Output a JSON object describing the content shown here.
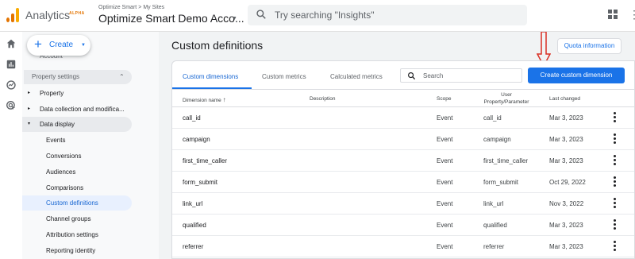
{
  "header": {
    "app_name": "Analytics",
    "badge": "ALPHA",
    "account_crumb_1": "Optimize Smart",
    "account_crumb_sep": ">",
    "account_crumb_2": "My Sites",
    "account_name": "Optimize Smart Demo Acco...",
    "search_placeholder": "Try searching \"Insights\"",
    "icons": [
      "apps-grid-icon",
      "more-vert-icon"
    ]
  },
  "rail": {
    "icons": [
      "home-icon",
      "reports-icon",
      "explore-icon",
      "advertising-icon"
    ]
  },
  "nav": {
    "create_label": "Create",
    "cut_item": "Account",
    "section_label": "Property settings",
    "items": [
      {
        "label": "Property",
        "arrow": "▸"
      },
      {
        "label": "Data collection and modifica...",
        "arrow": "▸"
      },
      {
        "label": "Data display",
        "arrow": "▾"
      },
      {
        "label": "Events"
      },
      {
        "label": "Conversions"
      },
      {
        "label": "Audiences"
      },
      {
        "label": "Comparisons"
      },
      {
        "label": "Custom definitions"
      },
      {
        "label": "Channel groups"
      },
      {
        "label": "Attribution settings"
      },
      {
        "label": "Reporting identity"
      }
    ]
  },
  "main": {
    "page_title": "Custom definitions",
    "quota_label": "Quota information",
    "tabs": [
      {
        "label": "Custom dimensions",
        "active": true
      },
      {
        "label": "Custom metrics"
      },
      {
        "label": "Calculated metrics"
      }
    ],
    "search_placeholder": "Search",
    "create_button": "Create custom dimension",
    "columns": {
      "name": "Dimension name",
      "sort_arrow": "↑",
      "description": "Description",
      "scope": "Scope",
      "user_property_1": "User",
      "user_property_2": "Property/Parameter",
      "last_changed": "Last changed"
    },
    "rows": [
      {
        "name": "call_id",
        "description": "",
        "scope": "Event",
        "param": "call_id",
        "changed": "Mar 3, 2023"
      },
      {
        "name": "campaign",
        "description": "",
        "scope": "Event",
        "param": "campaign",
        "changed": "Mar 3, 2023"
      },
      {
        "name": "first_time_caller",
        "description": "",
        "scope": "Event",
        "param": "first_time_caller",
        "changed": "Mar 3, 2023"
      },
      {
        "name": "form_submit",
        "description": "",
        "scope": "Event",
        "param": "form_submit",
        "changed": "Oct 29, 2022"
      },
      {
        "name": "link_url",
        "description": "",
        "scope": "Event",
        "param": "link_url",
        "changed": "Nov 3, 2022"
      },
      {
        "name": "qualified",
        "description": "",
        "scope": "Event",
        "param": "qualified",
        "changed": "Mar 3, 2023"
      },
      {
        "name": "referrer",
        "description": "",
        "scope": "Event",
        "param": "referrer",
        "changed": "Mar 3, 2023"
      }
    ]
  },
  "colors": {
    "accent": "#1a73e8",
    "annotation_arrow": "#d93025",
    "logo": "#f9ab00"
  }
}
